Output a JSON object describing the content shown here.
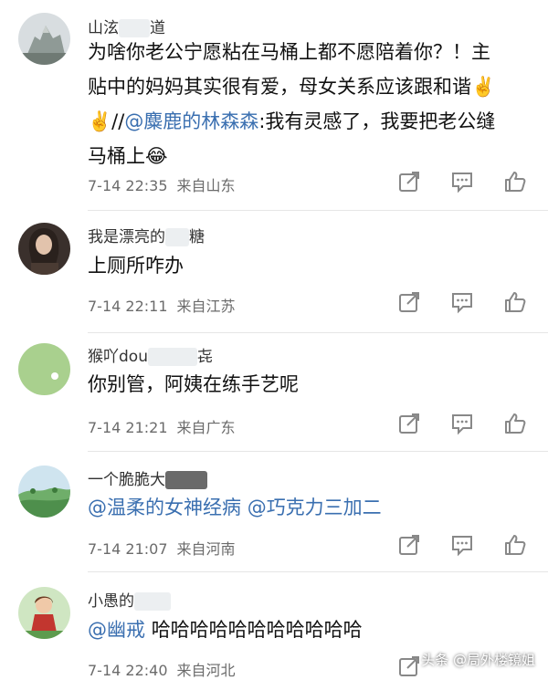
{
  "comments": [
    {
      "name": "山泫",
      "name_tail": "道",
      "text_lines": [
        "为啥你老公宁愿粘在马桶上都不愿陪着你？！主",
        "贴中的妈妈其实很有爱，母女关系应该跟和谐✌️"
      ],
      "repost_prefix": "✌️//",
      "mention": "@麋鹿的林森森",
      "repost_text": ":我有灵感了，我要把老公缝",
      "repost_text2": "马桶上😂",
      "date": "7-14 22:35",
      "location": "来自山东"
    },
    {
      "name": "我是漂亮的",
      "name_tail": "糖",
      "text": "上厕所咋办",
      "date": "7-14 22:11",
      "location": "来自江苏"
    },
    {
      "name": "猴吖dou",
      "name_tail": "㐂",
      "text": "你别管，阿姨在练手艺呢",
      "date": "7-14 21:21",
      "location": "来自广东"
    },
    {
      "name": "一个脆脆大",
      "name_tail": "",
      "mention1": "@温柔的女神经病",
      "mention2": "@巧克力三加二",
      "date": "7-14 21:07",
      "location": "来自河南"
    },
    {
      "name": "小愚的",
      "name_tail": "",
      "mention": "@幽戒",
      "text": "哈哈哈哈哈哈哈哈哈哈哈",
      "date": "7-14 22:40",
      "location": "来自河北"
    }
  ],
  "watermark": "头条 @局外楼镜姐",
  "icons": [
    "share-icon",
    "comment-icon",
    "like-icon"
  ],
  "colors": {
    "mention": "#3a6fb0",
    "meta": "#6b6b6b",
    "text": "#111111"
  }
}
